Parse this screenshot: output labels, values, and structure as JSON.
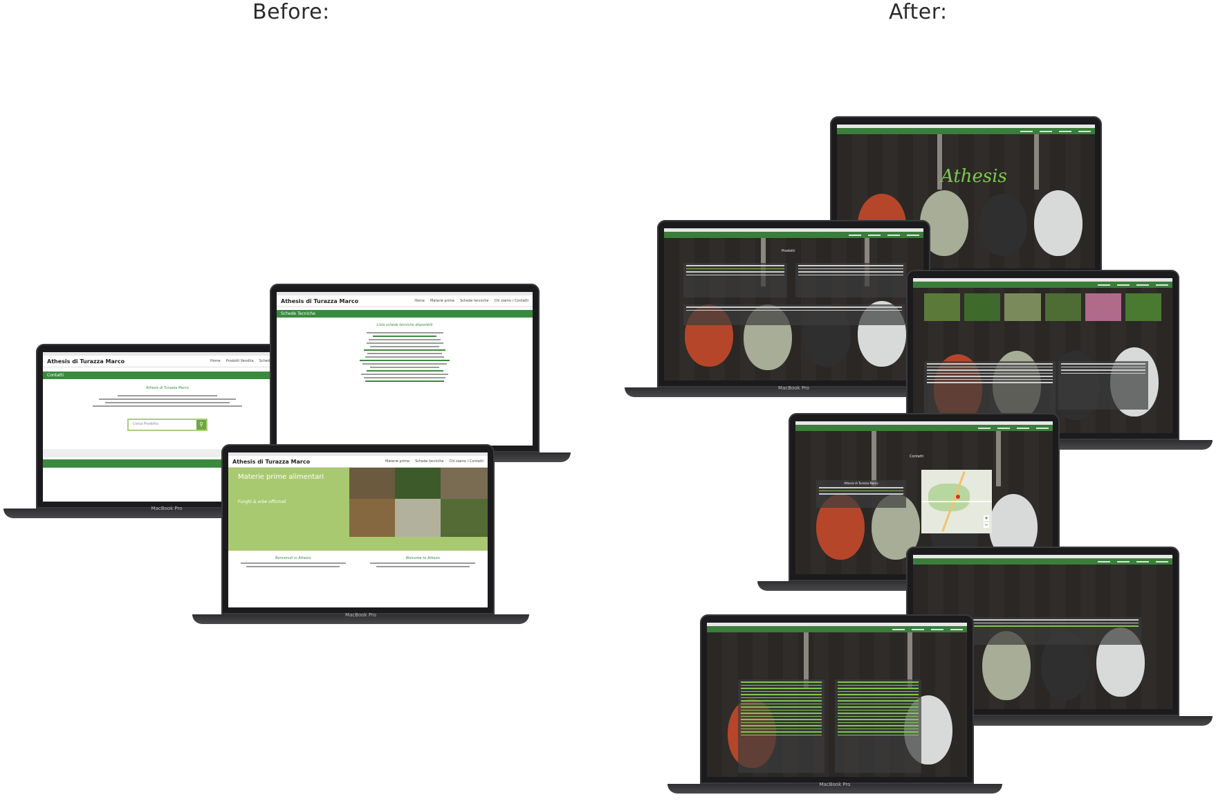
{
  "headings": {
    "before": "Before:",
    "after": "After:"
  },
  "laptop_brand": "MacBook Pro",
  "old_site": {
    "company": "Athesis di Turazza Marco",
    "nav": [
      "Home",
      "Prodotti Vendita",
      "Schede tecniche"
    ],
    "nav_full": [
      "Home",
      "Materie prime",
      "Schede tecniche",
      "Chi siamo / Contatti"
    ],
    "contatti_title": "Contatti",
    "contatti_company": "Athesis di Turazza Marco",
    "search_placeholder": "Cerca Prodotto",
    "schede_title": "Schede Tecniche",
    "schede_heading": "Lista schede tecniche disponibili",
    "hero_title": "Materie prime alimentari",
    "hero_subtitle": "Funghi & erbe officinali",
    "welcome_left": "Benvenuti in Athesis",
    "welcome_right": "Welcome to Athesis"
  },
  "new_site": {
    "hero_logo": "Athesis",
    "prodotti_title": "Prodotti",
    "contatti_title": "Contatti",
    "contact_company": "Athesis di Turazza Marco"
  },
  "colors": {
    "old_green": "#3a8a3e",
    "new_green": "#3b7d3b",
    "accent_lime": "#7ec850",
    "wood_dark": "#2a2725"
  }
}
